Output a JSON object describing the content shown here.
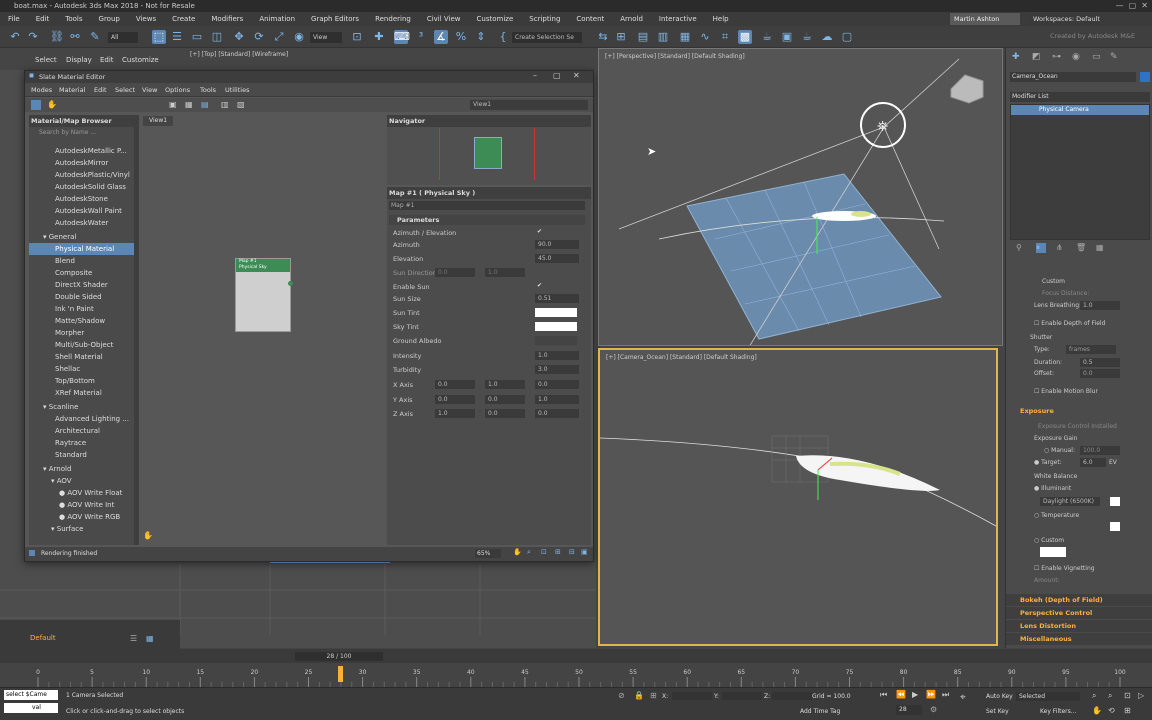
{
  "app": {
    "title": "boat.max - Autodesk 3ds Max 2018 - Not for Resale",
    "workspace_label": "Workspaces: Default",
    "user": "Martin Ashton",
    "autodesk_label": "Created by Autodesk M&E"
  },
  "menu": [
    "File",
    "Edit",
    "Tools",
    "Group",
    "Views",
    "Create",
    "Modifiers",
    "Animation",
    "Graph Editors",
    "Rendering",
    "Civil View",
    "Customize",
    "Scripting",
    "Content",
    "Arnold",
    "Interactive",
    "Help"
  ],
  "toolbar": {
    "selection_set": "Create Selection Se",
    "view_dropdown": "View",
    "filter_dropdown": "All"
  },
  "ribbon": {
    "items": [
      "Select",
      "Display",
      "Edit",
      "Customize"
    ]
  },
  "topleft_viewport_label": "[+] [Top] [Standard] [Wireframe]",
  "slate": {
    "title": "Slate Material Editor",
    "menu": [
      "Modes",
      "Material",
      "Edit",
      "Select",
      "View",
      "Options",
      "Tools",
      "Utilities"
    ],
    "view_dropdown": "View1",
    "browser_title": "Material/Map Browser",
    "search_placeholder": "Search by Name ...",
    "autodesk_items": [
      "AutodeskMetallic P...",
      "AutodeskMirror",
      "AutodeskPlastic/Vinyl",
      "AutodeskSolid Glass",
      "AutodeskStone",
      "AutodeskWall Paint",
      "AutodeskWater"
    ],
    "general_label": "General",
    "general_items": [
      "Physical Material",
      "Blend",
      "Composite",
      "DirectX Shader",
      "Double Sided",
      "Ink 'n Paint",
      "Matte/Shadow",
      "Morpher",
      "Multi/Sub-Object",
      "Shell Material",
      "Shellac",
      "Top/Bottom",
      "XRef Material"
    ],
    "scanline_label": "Scanline",
    "scanline_items": [
      "Advanced Lighting ...",
      "Architectural",
      "Raytrace",
      "Standard"
    ],
    "arnold_label": "Arnold",
    "aov_label": "AOV",
    "aov_items": [
      "AOV Write Float",
      "AOV Write Int",
      "AOV Write RGB"
    ],
    "surface_label": "Surface",
    "view_tab": "View1",
    "node_title": "Map #1",
    "node_subtitle": "Physical Sky",
    "navigator_title": "Navigator",
    "param_header": "Map #1  ( Physical Sky )",
    "param_name": "Map #1",
    "params_rollout": "Parameters",
    "status": "Rendering finished",
    "zoom": "65%",
    "params": {
      "azimuth_elevation": "Azimuth / Elevation",
      "azimuth": "Azimuth",
      "azimuth_val": "90.0",
      "elevation": "Elevation",
      "elevation_val": "45.0",
      "sun_direction": "Sun Direction",
      "sun_dir_a": "0.0",
      "sun_dir_b": "1.0",
      "enable_sun": "Enable Sun",
      "sun_size": "Sun Size",
      "sun_size_val": "0.51",
      "sun_tint": "Sun Tint",
      "sky_tint": "Sky Tint",
      "ground_albedo": "Ground Albedo",
      "intensity": "Intensity",
      "intensity_val": "1.0",
      "turbidity": "Turbidity",
      "turbidity_val": "3.0",
      "x_axis": "X Axis",
      "y_axis": "Y Axis",
      "z_axis": "Z Axis",
      "x_vals": [
        "0.0",
        "1.0",
        "0.0"
      ],
      "y_vals": [
        "0.0",
        "0.0",
        "1.0"
      ],
      "z_vals": [
        "1.0",
        "0.0",
        "0.0"
      ]
    }
  },
  "viewports": {
    "perspective_label": "[+] [Perspective] [Standard] [Default Shading]",
    "camera_label": "[+] [Camera_Ocean] [Standard] [Default Shading]"
  },
  "command_panel": {
    "object_name": "Camera_Ocean",
    "modifier_list": "Modifier List",
    "stack_item": "Physical Camera",
    "custom": "Custom",
    "focus_distance": "Focus Distance:",
    "lens_breathing": "Lens Breathing:",
    "lens_breathing_val": "1.0",
    "enable_dof": "Enable Depth of Field",
    "shutter": "Shutter",
    "type": "Type:",
    "type_val": "frames",
    "duration": "Duration:",
    "duration_val": "0.5",
    "offset": "Offset:",
    "offset_val": "0.0",
    "enable_motion_blur": "Enable Motion Blur",
    "exposure": "Exposure",
    "exposure_installed": "Exposure Control Installed",
    "exposure_gain": "Exposure Gain",
    "manual": "Manual:",
    "manual_val": "100.0",
    "target": "Target:",
    "target_val": "6.0",
    "target_unit": "EV",
    "white_balance": "White Balance",
    "illuminant": "Illuminant",
    "daylight": "Daylight (6500K)",
    "temperature": "Temperature",
    "custom_wb": "Custom",
    "enable_vignetting": "Enable Vignetting",
    "amount": "Amount:",
    "rollouts": [
      "Bokeh (Depth of Field)",
      "Perspective Control",
      "Lens Distortion",
      "Miscellaneous"
    ]
  },
  "timeline": {
    "frame_counter": "28 / 100",
    "ticks": [
      "0",
      "5",
      "10",
      "15",
      "20",
      "25",
      "30",
      "35",
      "40",
      "45",
      "50",
      "55",
      "60",
      "65",
      "70",
      "75",
      "80",
      "85",
      "90",
      "95",
      "100"
    ]
  },
  "statusbar": {
    "maxscript": "select $Came",
    "maxscript2": "val",
    "selected": "1 Camera Selected",
    "prompt": "Click or click-and-drag to select objects",
    "grid": "Grid = 100.0",
    "add_time_tag": "Add Time Tag",
    "x_label": "X:",
    "y_label": "Y:",
    "z_label": "Z:",
    "auto_key": "Auto Key",
    "set_key": "Set Key",
    "selected_dropdown": "Selected",
    "key_filters": "Key Filters...",
    "current_frame": "28",
    "default_layer": "Default"
  }
}
